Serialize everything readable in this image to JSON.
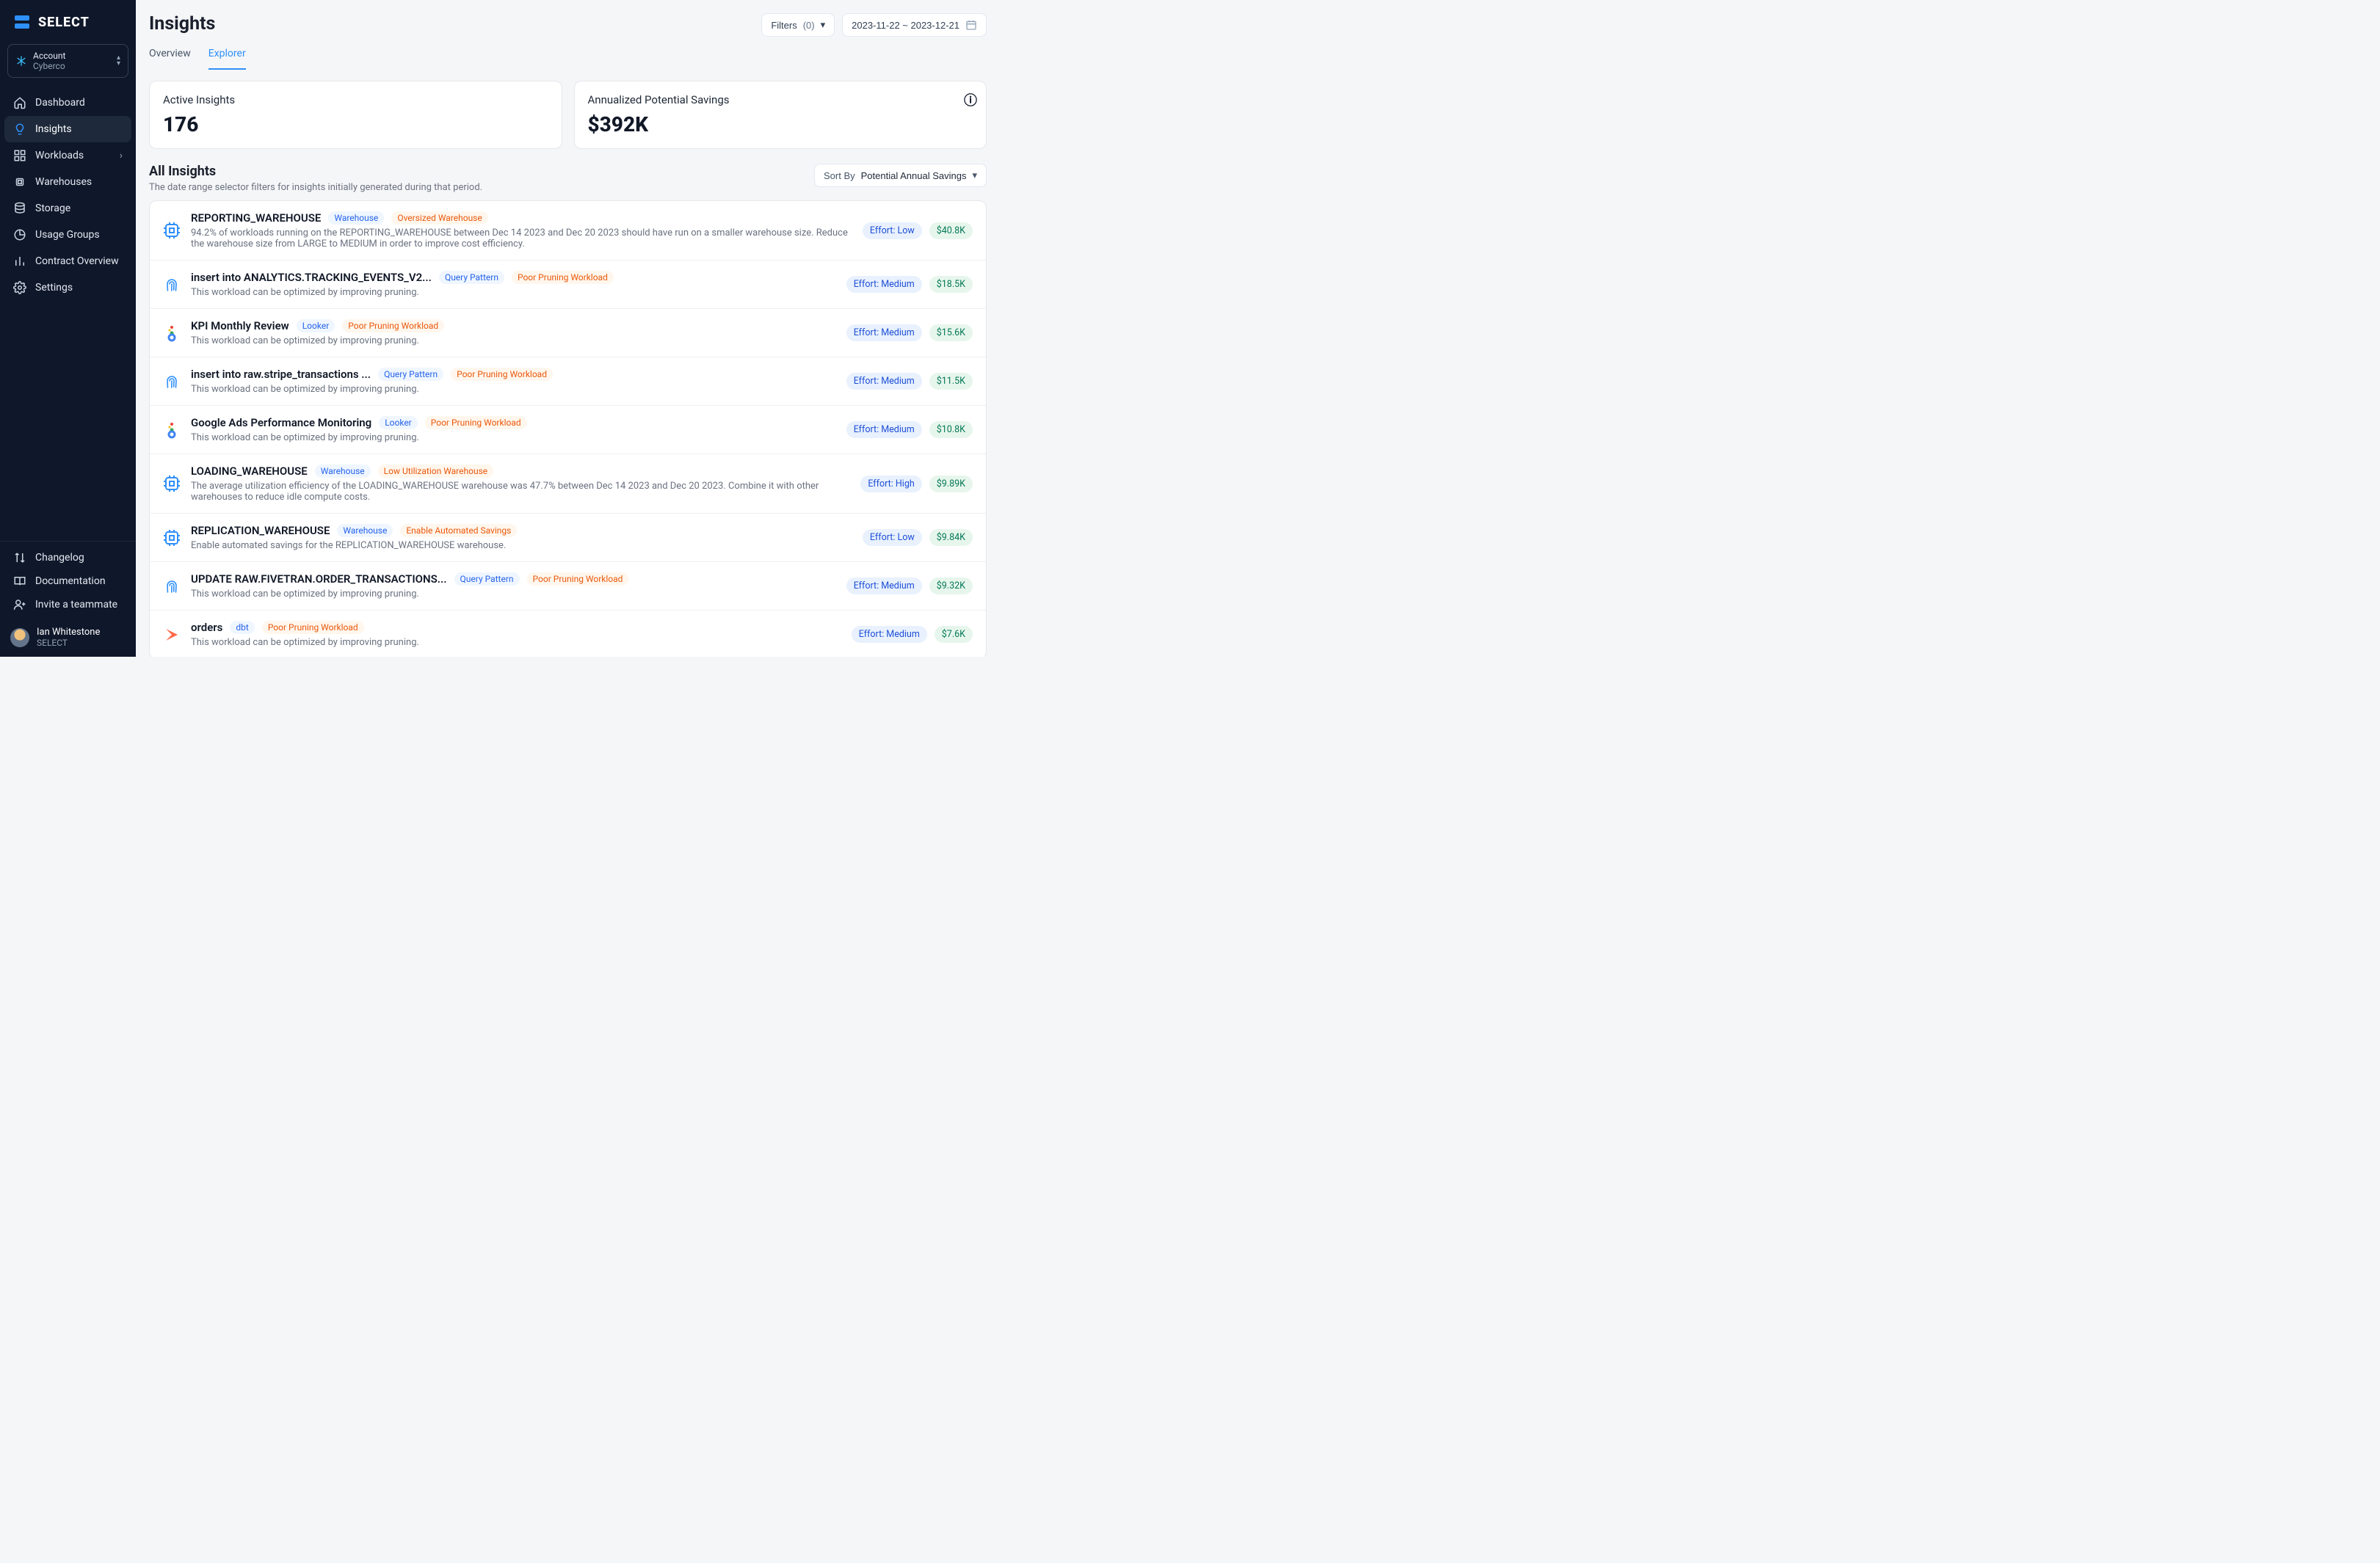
{
  "brand": {
    "name": "SELECT"
  },
  "account": {
    "label": "Account",
    "name": "Cyberco"
  },
  "nav": {
    "dashboard": "Dashboard",
    "insights": "Insights",
    "workloads": "Workloads",
    "warehouses": "Warehouses",
    "storage": "Storage",
    "usage_groups": "Usage Groups",
    "contract_overview": "Contract Overview",
    "settings": "Settings"
  },
  "bottom": {
    "changelog": "Changelog",
    "documentation": "Documentation",
    "invite": "Invite a teammate"
  },
  "user": {
    "name": "Ian Whitestone",
    "org": "SELECT"
  },
  "page": {
    "title": "Insights",
    "tabs": {
      "overview": "Overview",
      "explorer": "Explorer"
    },
    "filters_label": "Filters",
    "filters_count": "(0)",
    "date_range": "2023-11-22 ~ 2023-12-21"
  },
  "metrics": {
    "active_label": "Active Insights",
    "active_value": "176",
    "savings_label": "Annualized Potential Savings",
    "savings_value": "$392K"
  },
  "section": {
    "title": "All Insights",
    "subtitle": "The date range selector filters for insights initially generated during that period.",
    "sort_label": "Sort By",
    "sort_value": "Potential Annual Savings"
  },
  "insights": [
    {
      "icon": "cpu",
      "title": "REPORTING_WAREHOUSE",
      "tag1": "Warehouse",
      "tag2": "Oversized Warehouse",
      "desc": "94.2% of workloads running on the REPORTING_WAREHOUSE between Dec 14 2023 and Dec 20 2023 should have run on a smaller warehouse size. Reduce the warehouse size from LARGE to MEDIUM in order to improve cost efficiency.",
      "effort": "Effort: Low",
      "savings": "$40.8K"
    },
    {
      "icon": "fingerprint",
      "title": "insert into ANALYTICS.TRACKING_EVENTS_V2...",
      "tag1": "Query Pattern",
      "tag2": "Poor Pruning Workload",
      "desc": "This workload can be optimized by improving pruning.",
      "effort": "Effort: Medium",
      "savings": "$18.5K"
    },
    {
      "icon": "looker",
      "title": "KPI Monthly Review",
      "tag1": "Looker",
      "tag2": "Poor Pruning Workload",
      "desc": "This workload can be optimized by improving pruning.",
      "effort": "Effort: Medium",
      "savings": "$15.6K"
    },
    {
      "icon": "fingerprint",
      "title": "insert into raw.stripe_transactions ...",
      "tag1": "Query Pattern",
      "tag2": "Poor Pruning Workload",
      "desc": "This workload can be optimized by improving pruning.",
      "effort": "Effort: Medium",
      "savings": "$11.5K"
    },
    {
      "icon": "looker",
      "title": "Google Ads Performance Monitoring",
      "tag1": "Looker",
      "tag2": "Poor Pruning Workload",
      "desc": "This workload can be optimized by improving pruning.",
      "effort": "Effort: Medium",
      "savings": "$10.8K"
    },
    {
      "icon": "cpu",
      "title": "LOADING_WAREHOUSE",
      "tag1": "Warehouse",
      "tag2": "Low Utilization Warehouse",
      "desc": "The average utilization efficiency of the LOADING_WAREHOUSE warehouse was 47.7% between Dec 14 2023 and Dec 20 2023. Combine it with other warehouses to reduce idle compute costs.",
      "effort": "Effort: High",
      "savings": "$9.89K"
    },
    {
      "icon": "cpu",
      "title": "REPLICATION_WAREHOUSE",
      "tag1": "Warehouse",
      "tag2": "Enable Automated Savings",
      "desc": "Enable automated savings for the REPLICATION_WAREHOUSE warehouse.",
      "effort": "Effort: Low",
      "savings": "$9.84K"
    },
    {
      "icon": "fingerprint",
      "title": "UPDATE RAW.FIVETRAN.ORDER_TRANSACTIONS...",
      "tag1": "Query Pattern",
      "tag2": "Poor Pruning Workload",
      "desc": "This workload can be optimized by improving pruning.",
      "effort": "Effort: Medium",
      "savings": "$9.32K"
    },
    {
      "icon": "dbt",
      "title": "orders",
      "tag1": "dbt",
      "tag2": "Poor Pruning Workload",
      "desc": "This workload can be optimized by improving pruning.",
      "effort": "Effort: Medium",
      "savings": "$7.6K"
    }
  ]
}
